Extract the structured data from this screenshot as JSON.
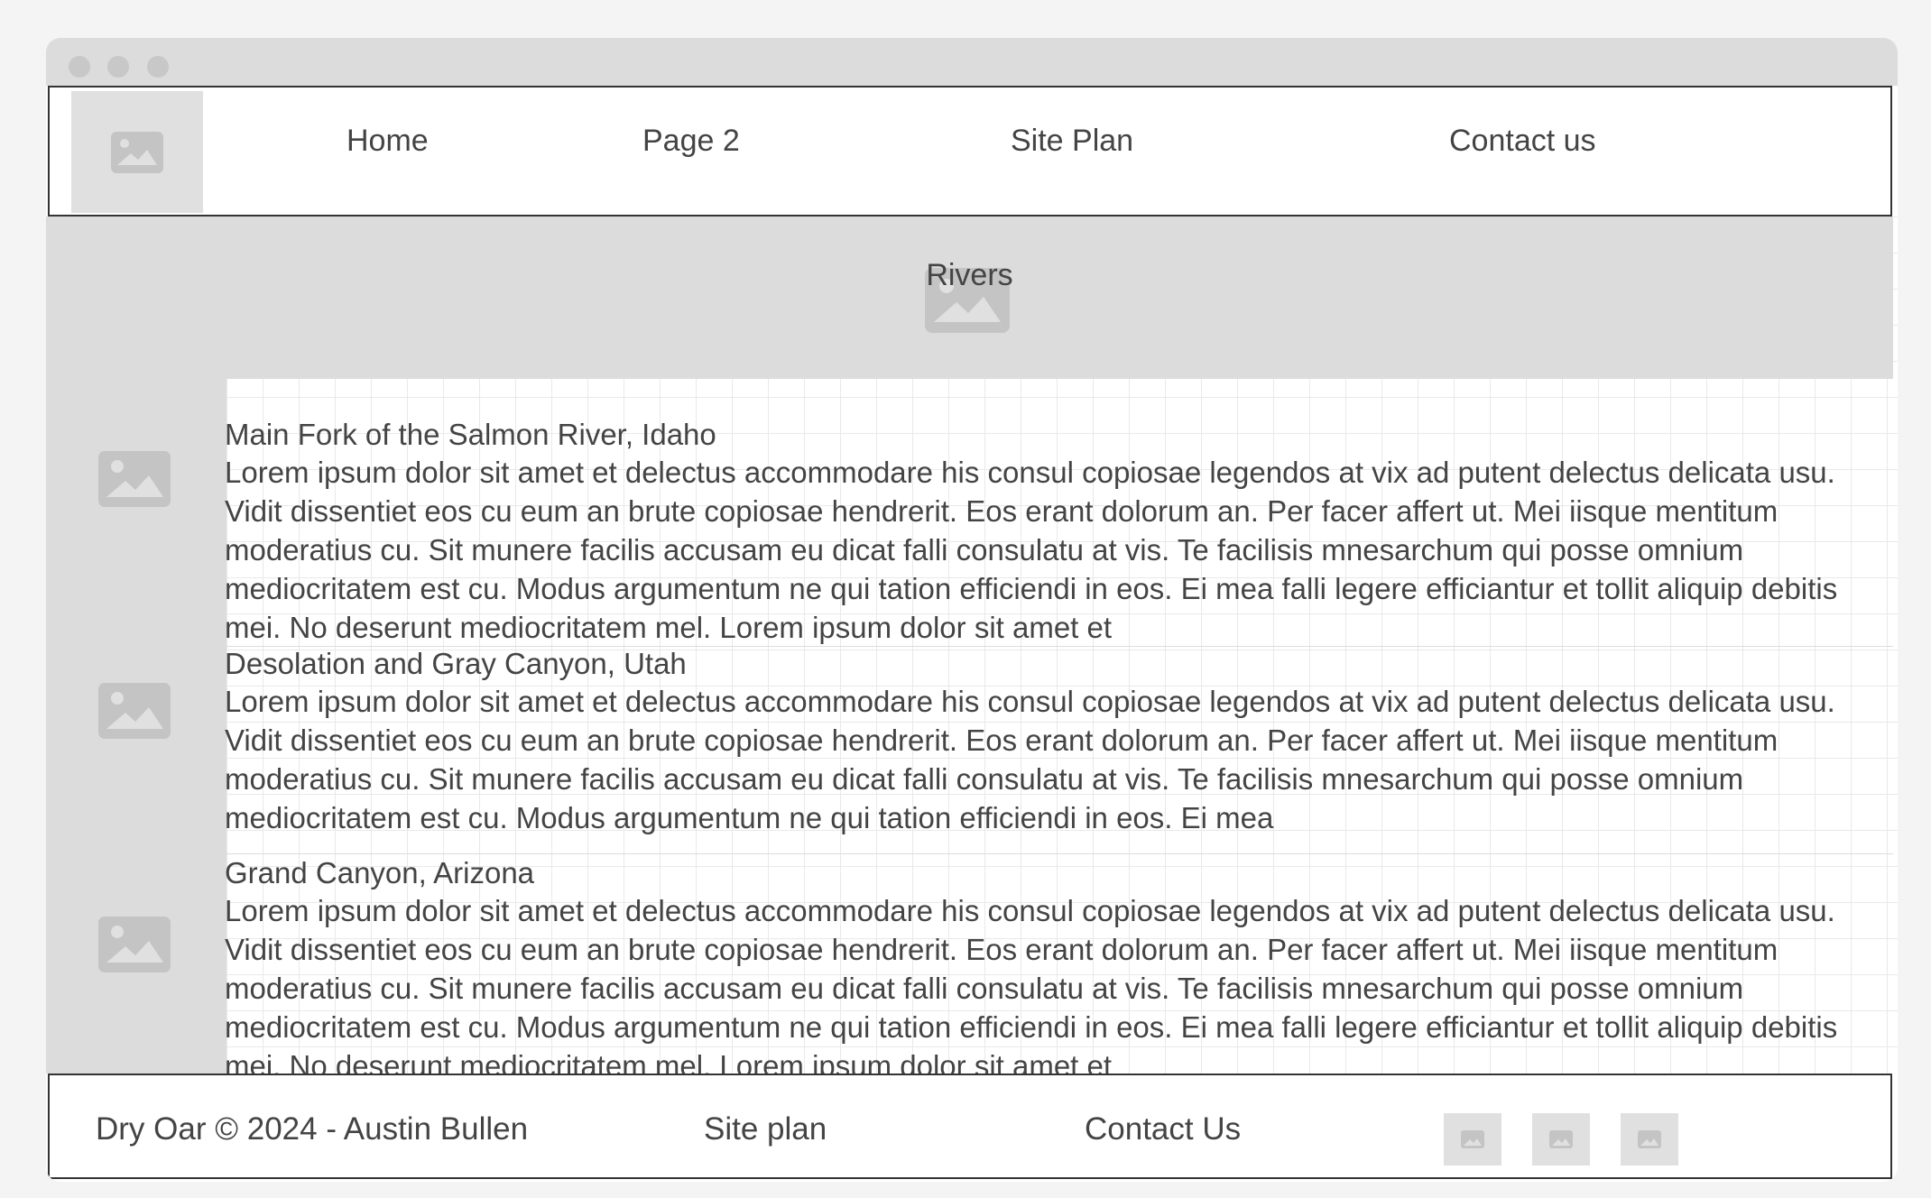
{
  "nav": {
    "logo_icon": "image-placeholder-icon",
    "items": [
      {
        "label": "Home"
      },
      {
        "label": "Page 2"
      },
      {
        "label": "Site Plan"
      },
      {
        "label": "Contact us"
      }
    ]
  },
  "hero": {
    "title": "Rivers",
    "icon": "image-placeholder-icon"
  },
  "articles": [
    {
      "title": "Main Fork of the Salmon River, Idaho",
      "body": "Lorem ipsum dolor sit amet et delectus accommodare his consul copiosae legendos at vix ad putent delectus delicata usu. Vidit dissentiet eos cu eum an brute copiosae hendrerit. Eos erant dolorum an. Per facer affert ut. Mei iisque mentitum moderatius cu. Sit munere facilis accusam eu dicat falli consulatu at vis. Te facilisis mnesarchum qui posse omnium mediocritatem est cu. Modus argumentum ne qui tation efficiendi in eos. Ei mea falli legere efficiantur et tollit aliquip debitis mei. No deserunt mediocritatem mel. Lorem ipsum dolor sit amet et"
    },
    {
      "title": "Desolation and Gray Canyon, Utah",
      "body": "Lorem ipsum dolor sit amet et delectus accommodare his consul copiosae legendos at vix ad putent delectus delicata usu. Vidit dissentiet eos cu eum an brute copiosae hendrerit. Eos erant dolorum an. Per facer affert ut. Mei iisque mentitum moderatius cu. Sit munere facilis accusam eu dicat falli consulatu at vis. Te facilisis mnesarchum qui posse omnium mediocritatem est cu. Modus argumentum ne qui tation efficiendi in eos. Ei mea"
    },
    {
      "title": "Grand Canyon, Arizona",
      "body": "Lorem ipsum dolor sit amet et delectus accommodare his consul copiosae legendos at vix ad putent delectus delicata usu. Vidit dissentiet eos cu eum an brute copiosae hendrerit. Eos erant dolorum an. Per facer affert ut. Mei iisque mentitum moderatius cu. Sit munere facilis accusam eu dicat falli consulatu at vis. Te facilisis mnesarchum qui posse omnium mediocritatem est cu. Modus argumentum ne qui tation efficiendi in eos. Ei mea falli legere efficiantur et tollit aliquip debitis mei. No deserunt mediocritatem mel. Lorem ipsum dolor sit amet et"
    }
  ],
  "footer": {
    "copyright": "Dry Oar © 2024 - Austin Bullen",
    "site_plan": "Site plan",
    "contact": "Contact Us",
    "social_icons": [
      "image-placeholder-icon",
      "image-placeholder-icon",
      "image-placeholder-icon"
    ]
  },
  "colors": {
    "background": "#f4f4f4",
    "placeholder": "#dcdcdc",
    "icon": "#c4c4c4",
    "text": "#444444",
    "border": "#333333"
  }
}
